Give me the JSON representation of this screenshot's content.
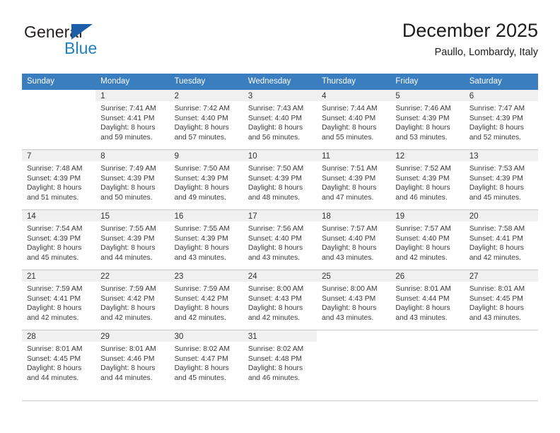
{
  "brand": {
    "name_part1": "General",
    "name_part2": "Blue",
    "logo_icon": "triangle-flag-icon",
    "colors": {
      "dark_text": "#231f20",
      "blue_text": "#1f7fc4",
      "flag_blue": "#1a5fa8"
    }
  },
  "header": {
    "title": "December 2025",
    "subtitle": "Paullo, Lombardy, Italy",
    "header_bg": "#3a7ebf",
    "daynum_bg": "#f0f0f0"
  },
  "weekdays": [
    "Sunday",
    "Monday",
    "Tuesday",
    "Wednesday",
    "Thursday",
    "Friday",
    "Saturday"
  ],
  "weeks": [
    [
      {
        "day": "",
        "sunrise": "",
        "sunset": "",
        "daylight1": "",
        "daylight2": ""
      },
      {
        "day": "1",
        "sunrise": "Sunrise: 7:41 AM",
        "sunset": "Sunset: 4:41 PM",
        "daylight1": "Daylight: 8 hours",
        "daylight2": "and 59 minutes."
      },
      {
        "day": "2",
        "sunrise": "Sunrise: 7:42 AM",
        "sunset": "Sunset: 4:40 PM",
        "daylight1": "Daylight: 8 hours",
        "daylight2": "and 57 minutes."
      },
      {
        "day": "3",
        "sunrise": "Sunrise: 7:43 AM",
        "sunset": "Sunset: 4:40 PM",
        "daylight1": "Daylight: 8 hours",
        "daylight2": "and 56 minutes."
      },
      {
        "day": "4",
        "sunrise": "Sunrise: 7:44 AM",
        "sunset": "Sunset: 4:40 PM",
        "daylight1": "Daylight: 8 hours",
        "daylight2": "and 55 minutes."
      },
      {
        "day": "5",
        "sunrise": "Sunrise: 7:46 AM",
        "sunset": "Sunset: 4:39 PM",
        "daylight1": "Daylight: 8 hours",
        "daylight2": "and 53 minutes."
      },
      {
        "day": "6",
        "sunrise": "Sunrise: 7:47 AM",
        "sunset": "Sunset: 4:39 PM",
        "daylight1": "Daylight: 8 hours",
        "daylight2": "and 52 minutes."
      }
    ],
    [
      {
        "day": "7",
        "sunrise": "Sunrise: 7:48 AM",
        "sunset": "Sunset: 4:39 PM",
        "daylight1": "Daylight: 8 hours",
        "daylight2": "and 51 minutes."
      },
      {
        "day": "8",
        "sunrise": "Sunrise: 7:49 AM",
        "sunset": "Sunset: 4:39 PM",
        "daylight1": "Daylight: 8 hours",
        "daylight2": "and 50 minutes."
      },
      {
        "day": "9",
        "sunrise": "Sunrise: 7:50 AM",
        "sunset": "Sunset: 4:39 PM",
        "daylight1": "Daylight: 8 hours",
        "daylight2": "and 49 minutes."
      },
      {
        "day": "10",
        "sunrise": "Sunrise: 7:50 AM",
        "sunset": "Sunset: 4:39 PM",
        "daylight1": "Daylight: 8 hours",
        "daylight2": "and 48 minutes."
      },
      {
        "day": "11",
        "sunrise": "Sunrise: 7:51 AM",
        "sunset": "Sunset: 4:39 PM",
        "daylight1": "Daylight: 8 hours",
        "daylight2": "and 47 minutes."
      },
      {
        "day": "12",
        "sunrise": "Sunrise: 7:52 AM",
        "sunset": "Sunset: 4:39 PM",
        "daylight1": "Daylight: 8 hours",
        "daylight2": "and 46 minutes."
      },
      {
        "day": "13",
        "sunrise": "Sunrise: 7:53 AM",
        "sunset": "Sunset: 4:39 PM",
        "daylight1": "Daylight: 8 hours",
        "daylight2": "and 45 minutes."
      }
    ],
    [
      {
        "day": "14",
        "sunrise": "Sunrise: 7:54 AM",
        "sunset": "Sunset: 4:39 PM",
        "daylight1": "Daylight: 8 hours",
        "daylight2": "and 45 minutes."
      },
      {
        "day": "15",
        "sunrise": "Sunrise: 7:55 AM",
        "sunset": "Sunset: 4:39 PM",
        "daylight1": "Daylight: 8 hours",
        "daylight2": "and 44 minutes."
      },
      {
        "day": "16",
        "sunrise": "Sunrise: 7:55 AM",
        "sunset": "Sunset: 4:39 PM",
        "daylight1": "Daylight: 8 hours",
        "daylight2": "and 43 minutes."
      },
      {
        "day": "17",
        "sunrise": "Sunrise: 7:56 AM",
        "sunset": "Sunset: 4:40 PM",
        "daylight1": "Daylight: 8 hours",
        "daylight2": "and 43 minutes."
      },
      {
        "day": "18",
        "sunrise": "Sunrise: 7:57 AM",
        "sunset": "Sunset: 4:40 PM",
        "daylight1": "Daylight: 8 hours",
        "daylight2": "and 43 minutes."
      },
      {
        "day": "19",
        "sunrise": "Sunrise: 7:57 AM",
        "sunset": "Sunset: 4:40 PM",
        "daylight1": "Daylight: 8 hours",
        "daylight2": "and 42 minutes."
      },
      {
        "day": "20",
        "sunrise": "Sunrise: 7:58 AM",
        "sunset": "Sunset: 4:41 PM",
        "daylight1": "Daylight: 8 hours",
        "daylight2": "and 42 minutes."
      }
    ],
    [
      {
        "day": "21",
        "sunrise": "Sunrise: 7:59 AM",
        "sunset": "Sunset: 4:41 PM",
        "daylight1": "Daylight: 8 hours",
        "daylight2": "and 42 minutes."
      },
      {
        "day": "22",
        "sunrise": "Sunrise: 7:59 AM",
        "sunset": "Sunset: 4:42 PM",
        "daylight1": "Daylight: 8 hours",
        "daylight2": "and 42 minutes."
      },
      {
        "day": "23",
        "sunrise": "Sunrise: 7:59 AM",
        "sunset": "Sunset: 4:42 PM",
        "daylight1": "Daylight: 8 hours",
        "daylight2": "and 42 minutes."
      },
      {
        "day": "24",
        "sunrise": "Sunrise: 8:00 AM",
        "sunset": "Sunset: 4:43 PM",
        "daylight1": "Daylight: 8 hours",
        "daylight2": "and 42 minutes."
      },
      {
        "day": "25",
        "sunrise": "Sunrise: 8:00 AM",
        "sunset": "Sunset: 4:43 PM",
        "daylight1": "Daylight: 8 hours",
        "daylight2": "and 43 minutes."
      },
      {
        "day": "26",
        "sunrise": "Sunrise: 8:01 AM",
        "sunset": "Sunset: 4:44 PM",
        "daylight1": "Daylight: 8 hours",
        "daylight2": "and 43 minutes."
      },
      {
        "day": "27",
        "sunrise": "Sunrise: 8:01 AM",
        "sunset": "Sunset: 4:45 PM",
        "daylight1": "Daylight: 8 hours",
        "daylight2": "and 43 minutes."
      }
    ],
    [
      {
        "day": "28",
        "sunrise": "Sunrise: 8:01 AM",
        "sunset": "Sunset: 4:45 PM",
        "daylight1": "Daylight: 8 hours",
        "daylight2": "and 44 minutes."
      },
      {
        "day": "29",
        "sunrise": "Sunrise: 8:01 AM",
        "sunset": "Sunset: 4:46 PM",
        "daylight1": "Daylight: 8 hours",
        "daylight2": "and 44 minutes."
      },
      {
        "day": "30",
        "sunrise": "Sunrise: 8:02 AM",
        "sunset": "Sunset: 4:47 PM",
        "daylight1": "Daylight: 8 hours",
        "daylight2": "and 45 minutes."
      },
      {
        "day": "31",
        "sunrise": "Sunrise: 8:02 AM",
        "sunset": "Sunset: 4:48 PM",
        "daylight1": "Daylight: 8 hours",
        "daylight2": "and 46 minutes."
      },
      {
        "day": "",
        "sunrise": "",
        "sunset": "",
        "daylight1": "",
        "daylight2": ""
      },
      {
        "day": "",
        "sunrise": "",
        "sunset": "",
        "daylight1": "",
        "daylight2": ""
      },
      {
        "day": "",
        "sunrise": "",
        "sunset": "",
        "daylight1": "",
        "daylight2": ""
      }
    ]
  ]
}
